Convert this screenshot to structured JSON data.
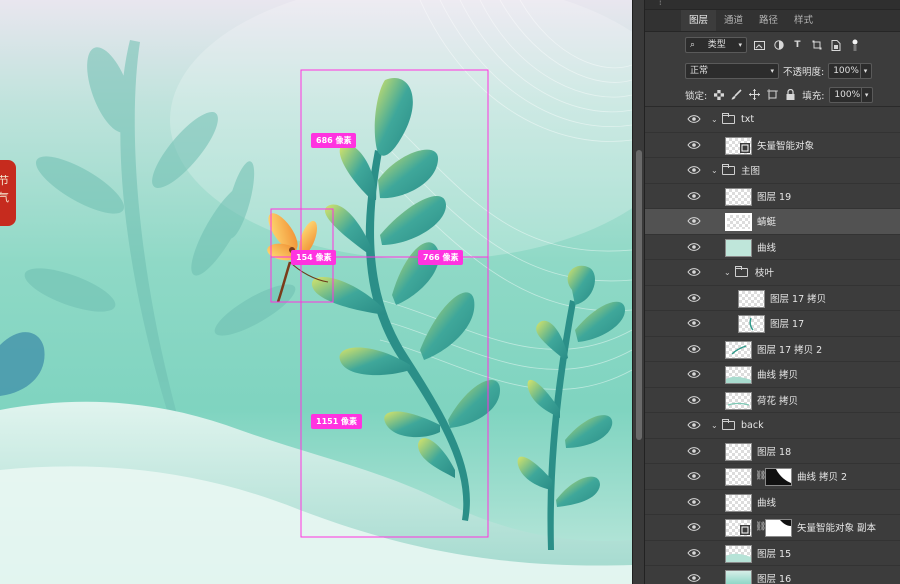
{
  "canvas": {
    "measurements": {
      "top_height": "686 像素",
      "small_width": "154 像素",
      "right_width": "766 像素",
      "bottom_height": "1151 像素"
    },
    "stamp_text": [
      "节",
      "气"
    ],
    "colors": {
      "guide": "#ff33e0",
      "stamp": "#c62b1e"
    }
  },
  "panel": {
    "tabs": [
      "图层",
      "通道",
      "路径",
      "样式"
    ],
    "filter_kind": "类型",
    "blend_mode": "正常",
    "opacity_label": "不透明度:",
    "opacity_value": "100%",
    "lock_label": "锁定:",
    "fill_label": "填充:",
    "fill_value": "100%",
    "layers": [
      {
        "name": "txt",
        "type": "group",
        "expanded": true
      },
      {
        "name": "矢量智能对象",
        "type": "smart"
      },
      {
        "name": "主图",
        "type": "group",
        "expanded": true
      },
      {
        "name": "图层 19",
        "type": "layer"
      },
      {
        "name": "蜻蜓",
        "type": "layer",
        "selected": true
      },
      {
        "name": "曲线",
        "type": "layer"
      },
      {
        "name": "枝叶",
        "type": "group",
        "expanded": true
      },
      {
        "name": "图层 17 拷贝",
        "type": "layer"
      },
      {
        "name": "图层 17",
        "type": "layer"
      },
      {
        "name": "图层 17 拷贝 2",
        "type": "layer"
      },
      {
        "name": "曲线 拷贝",
        "type": "layer"
      },
      {
        "name": "荷花 拷贝",
        "type": "layer"
      },
      {
        "name": "back",
        "type": "group",
        "expanded": true
      },
      {
        "name": "图层 18",
        "type": "layer"
      },
      {
        "name": "曲线 拷贝 2",
        "type": "masked"
      },
      {
        "name": "曲线",
        "type": "layer"
      },
      {
        "name": "矢量智能对象 副本",
        "type": "smart-masked"
      },
      {
        "name": "图层 15",
        "type": "layer"
      },
      {
        "name": "图层 16",
        "type": "layer"
      }
    ]
  }
}
